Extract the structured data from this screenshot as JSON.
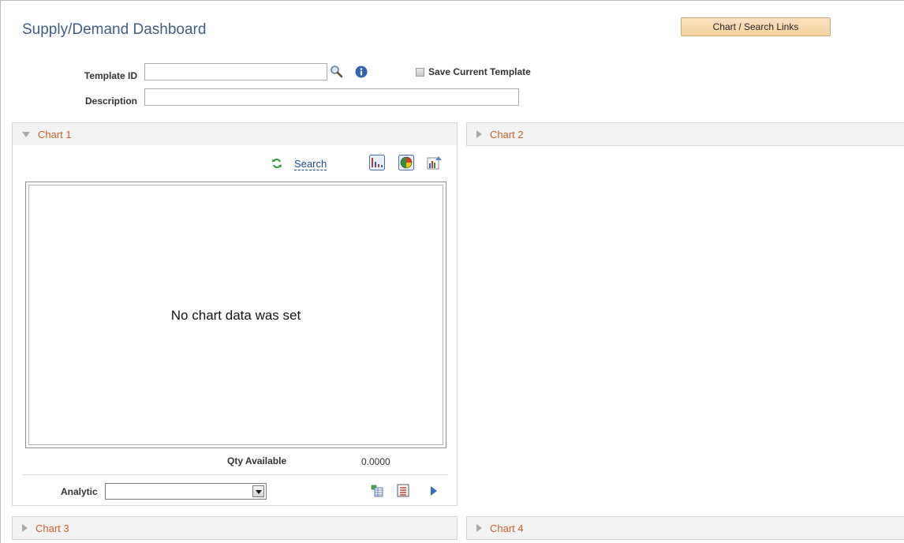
{
  "page": {
    "title": "Supply/Demand Dashboard",
    "links_button_label": "Chart / Search Links"
  },
  "form": {
    "template_id_label": "Template ID",
    "template_id_value": "",
    "description_label": "Description",
    "description_value": "",
    "save_template_label": "Save Current Template",
    "save_template_checked": false
  },
  "charts": {
    "chart1": {
      "title": "Chart 1",
      "expanded": true
    },
    "chart2": {
      "title": "Chart 2",
      "expanded": false
    },
    "chart3": {
      "title": "Chart 3",
      "expanded": false
    },
    "chart4": {
      "title": "Chart 4",
      "expanded": false
    }
  },
  "chart1_panel": {
    "search_label": "Search",
    "no_data_message": "No chart data was set",
    "qty_available_label": "Qty Available",
    "qty_available_value": "0.0000",
    "analytic_label": "Analytic",
    "analytic_value": ""
  },
  "icons": {
    "lookup": "magnifier-icon",
    "info": "info-icon",
    "refresh": "refresh-icon",
    "bar_chart": "bar-chart-icon",
    "pie_chart": "pie-chart-icon",
    "chart_options": "chart-options-icon",
    "grid_view": "grid-view-icon",
    "list_view": "list-view-icon",
    "next": "play-icon"
  },
  "colors": {
    "title": "#3f5d86",
    "section_title": "#c8602a",
    "link": "#1b4e8f",
    "button_bg": "#f6d3a0"
  }
}
